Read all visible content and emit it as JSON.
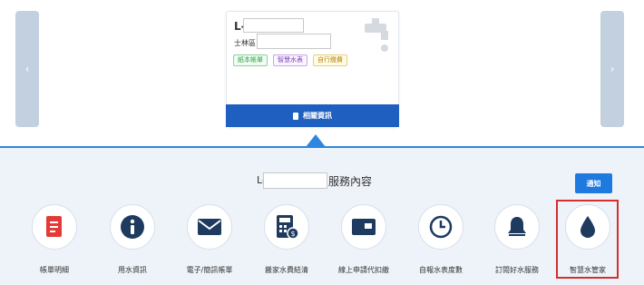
{
  "card": {
    "account_prefix": "L-",
    "district": "士林區",
    "tags": [
      "紙本帳單",
      "智慧水表",
      "自行繳費"
    ],
    "button_label": "相關資訊"
  },
  "services_section": {
    "account_prefix": "L-",
    "title": "服務內容",
    "notify_label": "通知"
  },
  "services": [
    {
      "label": "帳單明細",
      "icon": "bill-icon"
    },
    {
      "label": "用水資訊",
      "icon": "info-icon"
    },
    {
      "label": "電子/簡訊帳單",
      "icon": "envelope-icon"
    },
    {
      "label": "搬家水費結清",
      "icon": "calculator-icon"
    },
    {
      "label": "線上申請代扣繳",
      "icon": "card-icon"
    },
    {
      "label": "自報水表度數",
      "icon": "clock-icon"
    },
    {
      "label": "訂閱好水服務",
      "icon": "bell-icon"
    },
    {
      "label": "智慧水管家",
      "icon": "water-drop-icon"
    }
  ],
  "colors": {
    "primary": "#1f5fbf",
    "accent": "#2e86de",
    "icon_navy": "#1e3a5f",
    "bill_red": "#e53935",
    "highlight": "#d32f2f"
  }
}
